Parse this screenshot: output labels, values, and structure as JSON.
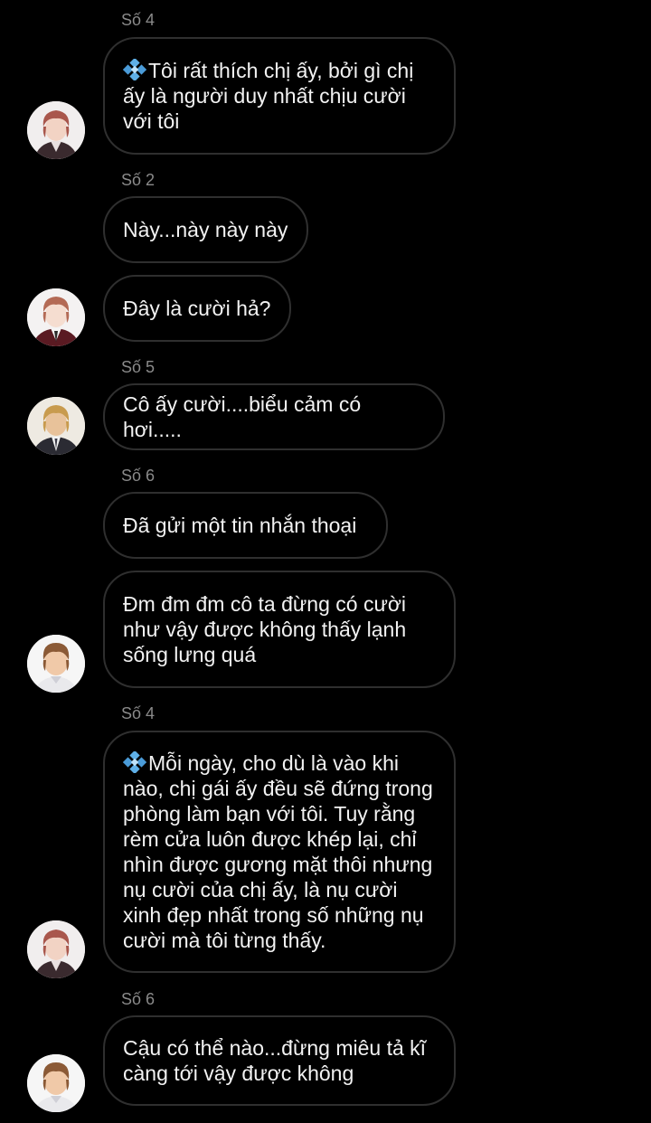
{
  "colors": {
    "background": "#000000",
    "bubble_border": "#2f2f2f",
    "sender_text": "#8a8a8a",
    "message_text": "#f2f2f2",
    "gem_icon": "#5fb0e8"
  },
  "messages": [
    {
      "sender": "Số 4",
      "icon": "blue-diamond-icon",
      "text": "Tôi rất thích chị ấy, bởi gì chị ấy là người duy nhất chịu cười với tôi",
      "avatar": "avatar-red-hair-boy"
    },
    {
      "sender": "Số 2",
      "text": "Này...này này này",
      "avatar": ""
    },
    {
      "sender": "",
      "text": "Đây là cười hả?",
      "avatar": "avatar-uniform-boy"
    },
    {
      "sender": "Số 5",
      "text": "Cô ấy cười....biểu cảm có hơi.....",
      "avatar": "avatar-blonde-suit-boy"
    },
    {
      "sender": "Số 6",
      "text": "Đã gửi một tin nhắn thoại",
      "avatar": ""
    },
    {
      "sender": "",
      "text": "Đm đm đm cô ta đừng có cười như vậy được không thấy lạnh sống lưng quá",
      "avatar": "avatar-brown-hair-boy"
    },
    {
      "sender": "Số 4",
      "icon": "blue-diamond-icon",
      "text": "Mỗi ngày, cho dù là vào khi nào, chị gái ấy đều sẽ đứng trong phòng làm bạn với tôi. Tuy rằng rèm cửa luôn được khép lại, chỉ nhìn được gương mặt thôi nhưng nụ cười của chị ấy, là nụ cười xinh đẹp nhất trong số những nụ cười mà tôi từng thấy.",
      "avatar": "avatar-red-hair-boy"
    },
    {
      "sender": "Số 6",
      "text": "Cậu có thể nào...đừng miêu tả kĩ càng tới vậy được không",
      "avatar": "avatar-brown-hair-boy"
    }
  ]
}
